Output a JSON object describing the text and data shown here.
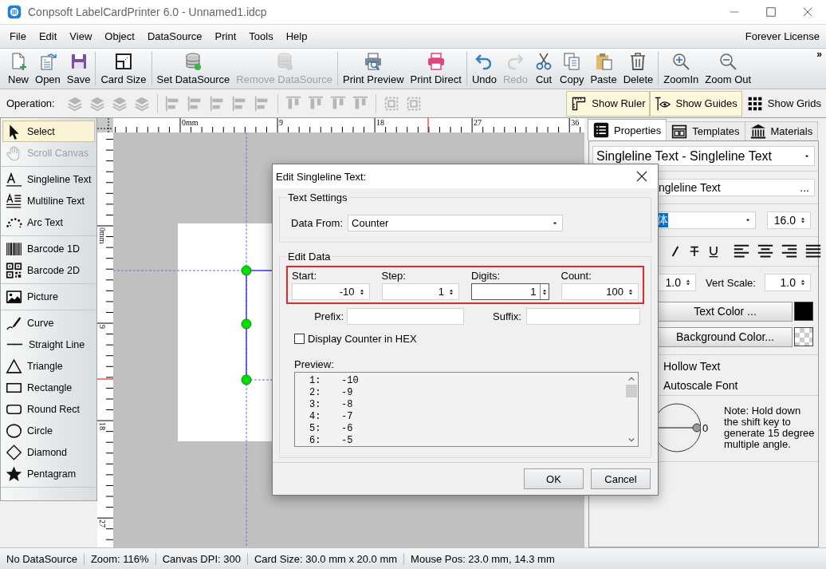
{
  "window": {
    "title": "Conpsoft LabelCardPrinter 6.0 - Unnamed1.idcp"
  },
  "menu": {
    "items": [
      "File",
      "Edit",
      "View",
      "Object",
      "DataSource",
      "Print",
      "Tools",
      "Help"
    ],
    "license": "Forever License"
  },
  "toolbar": {
    "groups": [
      [
        {
          "label": "New",
          "disabled": false
        },
        {
          "label": "Open",
          "disabled": false
        },
        {
          "label": "Save",
          "disabled": false
        }
      ],
      [
        {
          "label": "Card Size",
          "disabled": false
        }
      ],
      [
        {
          "label": "Set DataSource",
          "disabled": false
        },
        {
          "label": "Remove DataSource",
          "disabled": true
        }
      ],
      [
        {
          "label": "Print Preview",
          "disabled": false
        },
        {
          "label": "Print Direct",
          "disabled": false
        }
      ],
      [
        {
          "label": "Undo",
          "disabled": false
        },
        {
          "label": "Redo",
          "disabled": true
        },
        {
          "label": "Cut",
          "disabled": false
        },
        {
          "label": "Copy",
          "disabled": false
        },
        {
          "label": "Paste",
          "disabled": false
        },
        {
          "label": "Delete",
          "disabled": false
        }
      ],
      [
        {
          "label": "ZoomIn",
          "disabled": false
        },
        {
          "label": "Zoom Out",
          "disabled": false
        }
      ]
    ],
    "overflow": "»"
  },
  "operation_bar": {
    "label": "Operation:",
    "toggles": [
      {
        "label": "Show Ruler",
        "selected": true
      },
      {
        "label": "Show Guides",
        "selected": true
      },
      {
        "label": "Show Grids",
        "selected": false
      }
    ]
  },
  "toolbox": {
    "groups": [
      [
        {
          "label": "Select",
          "selected": true,
          "disabled": false
        },
        {
          "label": "Scroll Canvas",
          "selected": false,
          "disabled": true
        }
      ],
      [
        {
          "label": "Singleline Text",
          "selected": false,
          "disabled": false
        },
        {
          "label": "Multiline Text",
          "selected": false,
          "disabled": false
        },
        {
          "label": "Arc Text",
          "selected": false,
          "disabled": false
        }
      ],
      [
        {
          "label": "Barcode 1D",
          "selected": false,
          "disabled": false
        },
        {
          "label": "Barcode 2D",
          "selected": false,
          "disabled": false
        }
      ],
      [
        {
          "label": "Picture",
          "selected": false,
          "disabled": false
        }
      ],
      [
        {
          "label": "Curve",
          "selected": false,
          "disabled": false
        },
        {
          "label": "Straight Line",
          "selected": false,
          "disabled": false
        },
        {
          "label": "Triangle",
          "selected": false,
          "disabled": false
        },
        {
          "label": "Rectangle",
          "selected": false,
          "disabled": false
        },
        {
          "label": "Round Rect",
          "selected": false,
          "disabled": false
        },
        {
          "label": "Circle",
          "selected": false,
          "disabled": false
        },
        {
          "label": "Diamond",
          "selected": false,
          "disabled": false
        },
        {
          "label": "Pentagram",
          "selected": false,
          "disabled": false
        }
      ]
    ]
  },
  "canvas": {
    "top_ruler": [
      "0mm",
      "9",
      "18",
      "27",
      "36"
    ],
    "left_ruler": [
      "0mm",
      "9",
      "18",
      "27"
    ]
  },
  "properties": {
    "tabs": [
      {
        "label": "Properties",
        "selected": true
      },
      {
        "label": "Templates",
        "selected": false
      },
      {
        "label": "Materials",
        "selected": false
      }
    ],
    "object": "Singleline Text - Singleline Text",
    "content": "ngleline Text",
    "content_button": "...",
    "font": "体",
    "font_text_selected": true,
    "font_size": "16.0",
    "horz_scale": "1.0",
    "vert_scale_label": "Vert Scale:",
    "vert_scale": "1.0",
    "text_color_button": "Text Color ...",
    "background_color_button": "Background Color...",
    "options": [
      "Hollow Text",
      "Autoscale Font"
    ],
    "angle": "0",
    "note": "Note: Hold down the shift key to generate 15 degree multiple angle."
  },
  "dialog": {
    "title": "Edit Singleline Text:",
    "text_settings": {
      "title": "Text Settings",
      "data_from_label": "Data From:",
      "data_from": "Counter"
    },
    "edit_data": {
      "title": "Edit Data",
      "spinners": [
        {
          "label": "Start:",
          "value": "-10",
          "focused": false
        },
        {
          "label": "Step:",
          "value": "1",
          "focused": false
        },
        {
          "label": "Digits:",
          "value": "1",
          "focused": true
        },
        {
          "label": "Count:",
          "value": "100",
          "focused": false
        }
      ],
      "prefix_label": "Prefix:",
      "suffix_label": "Suffix:",
      "hex": {
        "label": "Display Counter in HEX",
        "checked": false
      },
      "preview_label": "Preview:",
      "preview": [
        {
          "index": "1:",
          "value": "-10"
        },
        {
          "index": "2:",
          "value": "-9"
        },
        {
          "index": "3:",
          "value": "-8"
        },
        {
          "index": "4:",
          "value": "-7"
        },
        {
          "index": "5:",
          "value": "-6"
        },
        {
          "index": "6:",
          "value": "-5"
        }
      ]
    },
    "buttons": [
      "OK",
      "Cancel"
    ]
  },
  "status_bar": [
    "No DataSource",
    "Zoom: 116%",
    "Canvas DPI: 300",
    "Card Size: 30.0 mm x 20.0 mm",
    "Mouse Pos: 23.0 mm, 14.3 mm"
  ]
}
